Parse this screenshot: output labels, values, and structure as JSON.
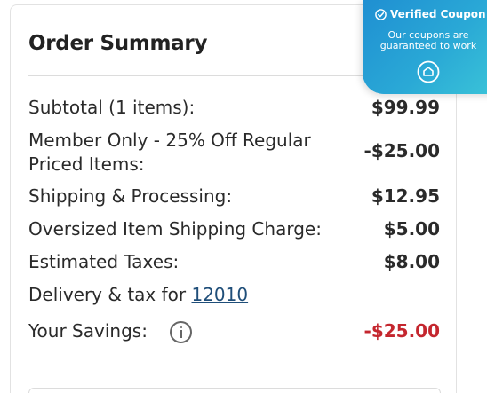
{
  "summary": {
    "title": "Order Summary",
    "rows": [
      {
        "label": "Subtotal (1 items):",
        "value": "$99.99"
      },
      {
        "label_line1": "Member Only - 25% Off Regular",
        "label_line2": "Priced Items:",
        "value": "-$25.00"
      },
      {
        "label": "Shipping & Processing:",
        "value": "$12.95"
      },
      {
        "label": "Oversized Item Shipping Charge:",
        "value": "$5.00"
      },
      {
        "label": "Estimated Taxes:",
        "value": "$8.00"
      }
    ],
    "delivery": {
      "prefix": "Delivery & tax for ",
      "zip": "12010"
    },
    "savings": {
      "label": "Your Savings:",
      "value": "-$25.00",
      "color": "#c4262e"
    },
    "info_icon": "info-icon"
  },
  "badge": {
    "title": "Verified Coupon",
    "line1": "Our coupons are",
    "line2": "guaranteed to work",
    "icons": [
      "check-circle-icon",
      "shield-icon"
    ],
    "gradient": [
      "#1f8fd2",
      "#3cc6d8"
    ]
  }
}
